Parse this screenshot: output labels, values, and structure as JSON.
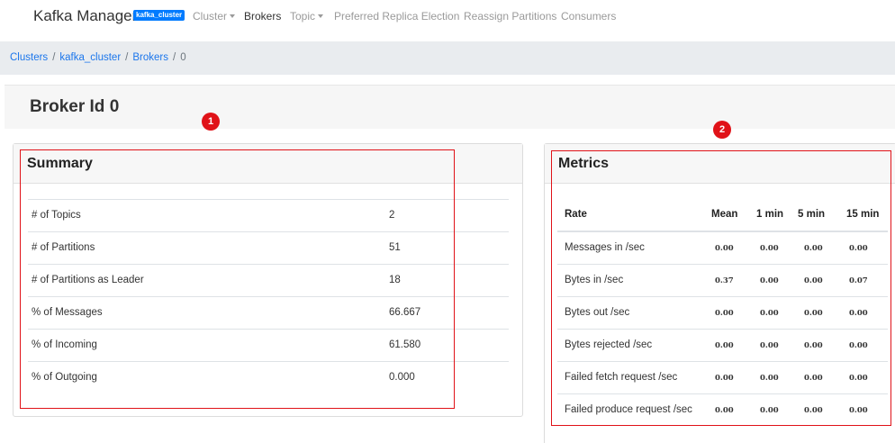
{
  "navbar": {
    "brand": "Kafka Manager",
    "cluster_badge": "kafka_cluster",
    "items": [
      "Cluster",
      "Brokers",
      "Topic",
      "Preferred Replica Election",
      "Reassign Partitions",
      "Consumers"
    ]
  },
  "breadcrumb": {
    "items": [
      "Clusters",
      "kafka_cluster",
      "Brokers"
    ],
    "current": "0",
    "separator": "/"
  },
  "page": {
    "title": "Broker Id 0"
  },
  "markers": [
    "1",
    "2"
  ],
  "summary": {
    "title": "Summary",
    "rows": [
      {
        "label": "# of Topics",
        "value": "2"
      },
      {
        "label": "# of Partitions",
        "value": "51"
      },
      {
        "label": "# of Partitions as Leader",
        "value": "18"
      },
      {
        "label": "% of Messages",
        "value": "66.667"
      },
      {
        "label": "% of Incoming",
        "value": "61.580"
      },
      {
        "label": "% of Outgoing",
        "value": "0.000"
      }
    ]
  },
  "metrics": {
    "title": "Metrics",
    "columns": [
      "Rate",
      "Mean",
      "1 min",
      "5 min",
      "15 min"
    ],
    "rows": [
      {
        "label": "Messages in /sec",
        "values": [
          "0.00",
          "0.00",
          "0.00",
          "0.00"
        ]
      },
      {
        "label": "Bytes in /sec",
        "values": [
          "0.37",
          "0.00",
          "0.00",
          "0.07"
        ]
      },
      {
        "label": "Bytes out /sec",
        "values": [
          "0.00",
          "0.00",
          "0.00",
          "0.00"
        ]
      },
      {
        "label": "Bytes rejected /sec",
        "values": [
          "0.00",
          "0.00",
          "0.00",
          "0.00"
        ]
      },
      {
        "label": "Failed fetch request /sec",
        "values": [
          "0.00",
          "0.00",
          "0.00",
          "0.00"
        ]
      },
      {
        "label": "Failed produce request /sec",
        "values": [
          "0.00",
          "0.00",
          "0.00",
          "0.00"
        ]
      }
    ]
  },
  "colors": {
    "accent": "#007bff",
    "link": "#1b76ec",
    "highlight": "#e01218",
    "breadcrumb_bg": "#e9ecef"
  }
}
